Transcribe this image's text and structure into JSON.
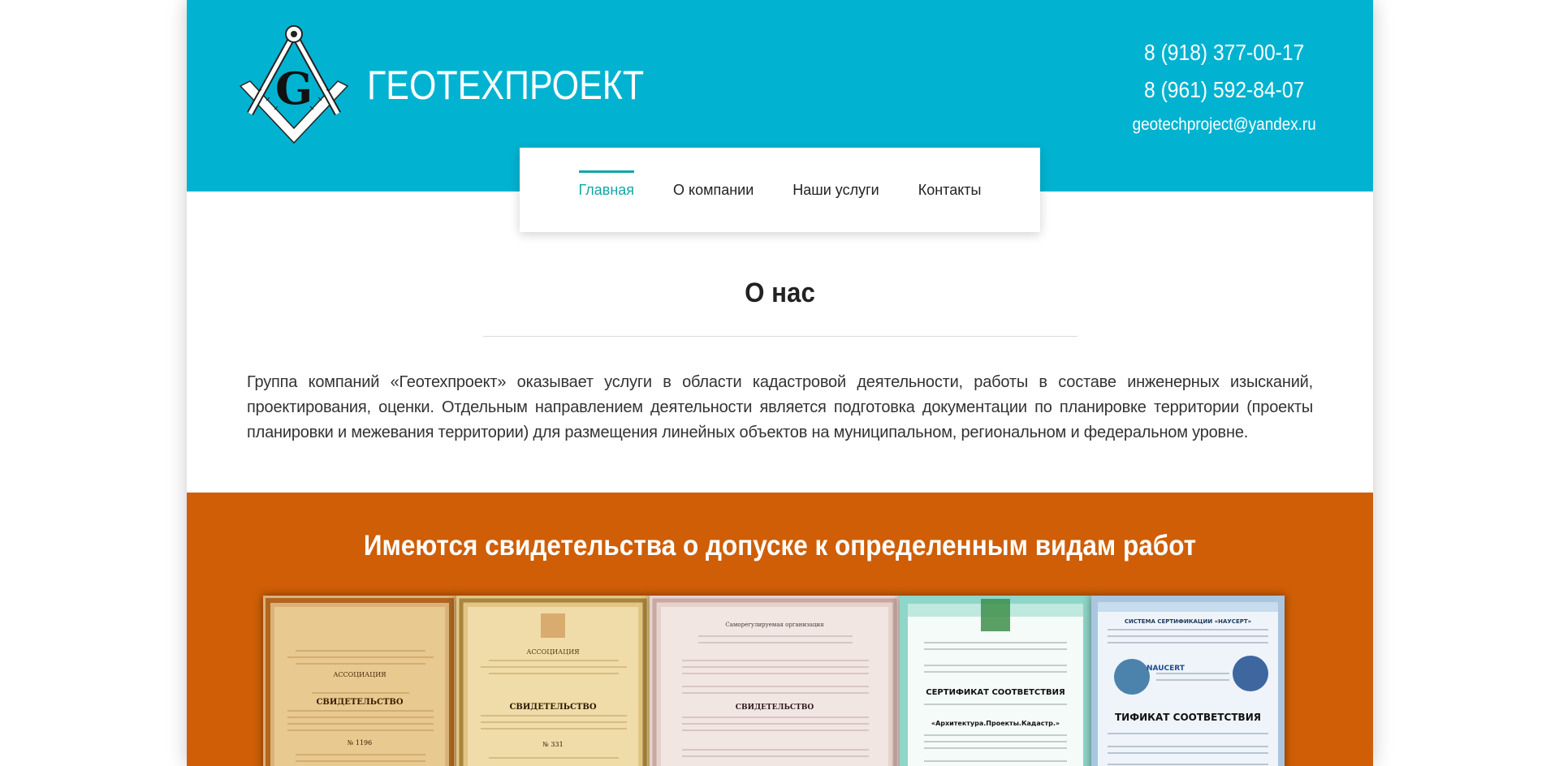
{
  "header": {
    "brand": "ГЕОТЕХПРОЕКТ",
    "logo_letter": "G",
    "phones": [
      "8 (918) 377-00-17",
      "8 (961) 592-84-07"
    ],
    "email": "geotechproject@yandex.ru",
    "background_color": "#01b3d1"
  },
  "nav": {
    "items": [
      "Главная",
      "О компании",
      "Наши услуги",
      "Контакты"
    ],
    "active_index": 0,
    "active_color": "#13a6a6"
  },
  "about": {
    "title": "О нас",
    "text": "Группа компаний «Геотехпроект» оказывает услуги в области кадастровой деятельности, работы в составе инженерных изысканий, проектирования, оценки. Отдельным направлением деятельности является подготовка документации по планировке территории (проекты планировки и межевания территории) для размещения линейных объектов на муниципальном, региональном и федеральном уровне."
  },
  "certificates": {
    "title": "Имеются свидетельства о допуске к определенным видам работ",
    "background_color": "#cf5e06",
    "items": [
      {
        "heading": "СВИДЕТЕЛЬСТВО",
        "org": "АССОЦИАЦИЯ",
        "number": "№ 1196",
        "icon": "certificate-icon"
      },
      {
        "heading": "СВИДЕТЕЛЬСТВО",
        "org": "АССОЦИАЦИЯ",
        "number": "№ 331",
        "icon": "certificate-icon"
      },
      {
        "heading": "СВИДЕТЕЛЬСТВО",
        "org": "Саморегулируемая организация",
        "number": "",
        "icon": "certificate-icon"
      },
      {
        "heading": "СЕРТИФИКАТ СООТВЕТСТВИЯ",
        "org": "«Архитектура.Проекты.Кадастр.»",
        "number": "",
        "icon": "certificate-icon"
      },
      {
        "heading": "ТИФИКАТ СООТВЕТСТВИЯ",
        "org": "СИСТЕМА СЕРТИФИКАЦИИ «НАУСЕРТ»",
        "number": "NAUCERT",
        "icon": "certificate-icon"
      }
    ]
  }
}
